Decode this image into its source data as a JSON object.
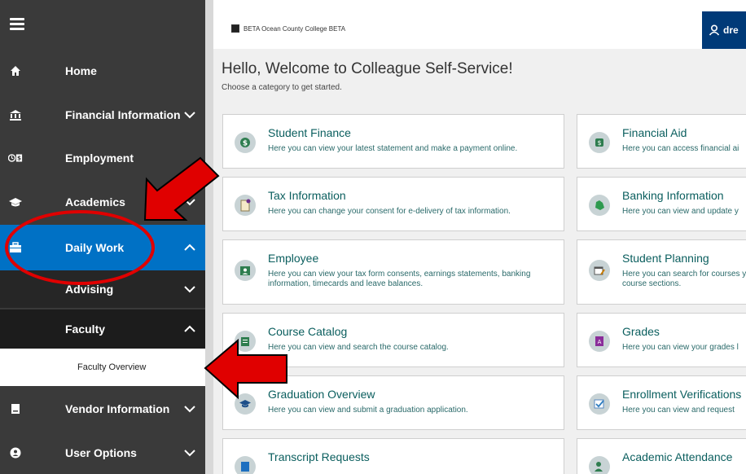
{
  "sidebar": {
    "items": [
      {
        "label": "Home"
      },
      {
        "label": "Financial Information"
      },
      {
        "label": "Employment"
      },
      {
        "label": "Academics"
      },
      {
        "label": "Daily Work"
      },
      {
        "label": "Advising"
      },
      {
        "label": "Faculty"
      },
      {
        "label": "Faculty Overview"
      },
      {
        "label": "Vendor Information"
      },
      {
        "label": "User Options"
      }
    ]
  },
  "header": {
    "college": "BETA Ocean County College BETA",
    "user_partial": "dre"
  },
  "main": {
    "welcome": "Hello, Welcome to Colleague Self-Service!",
    "subwelcome": "Choose a category to get started.",
    "cards": [
      {
        "title": "Student Finance",
        "desc": "Here you can view your latest statement and make a payment online."
      },
      {
        "title": "Financial Aid",
        "desc": "Here you can access financial ai"
      },
      {
        "title": "Tax Information",
        "desc": "Here you can change your consent for e-delivery of tax information."
      },
      {
        "title": "Banking Information",
        "desc": "Here you can view and update y"
      },
      {
        "title": "Employee",
        "desc": "Here you can view your tax form consents, earnings statements, banking information, timecards and leave balances."
      },
      {
        "title": "Student Planning",
        "desc": "Here you can search for courses your course sections."
      },
      {
        "title": "Course Catalog",
        "desc": "Here you can view and search the course catalog."
      },
      {
        "title": "Grades",
        "desc": "Here you can view your grades l"
      },
      {
        "title": "Graduation Overview",
        "desc": "Here you can view and submit a graduation application."
      },
      {
        "title": "Enrollment Verifications",
        "desc": "Here you can view and request"
      },
      {
        "title": "Transcript Requests",
        "desc": ""
      },
      {
        "title": "Academic Attendance",
        "desc": ""
      }
    ]
  },
  "colors": {
    "sidebar": "#3a3a3a",
    "active": "#0071c5",
    "annotation": "#e00000",
    "card_title": "#0a5e5e"
  }
}
